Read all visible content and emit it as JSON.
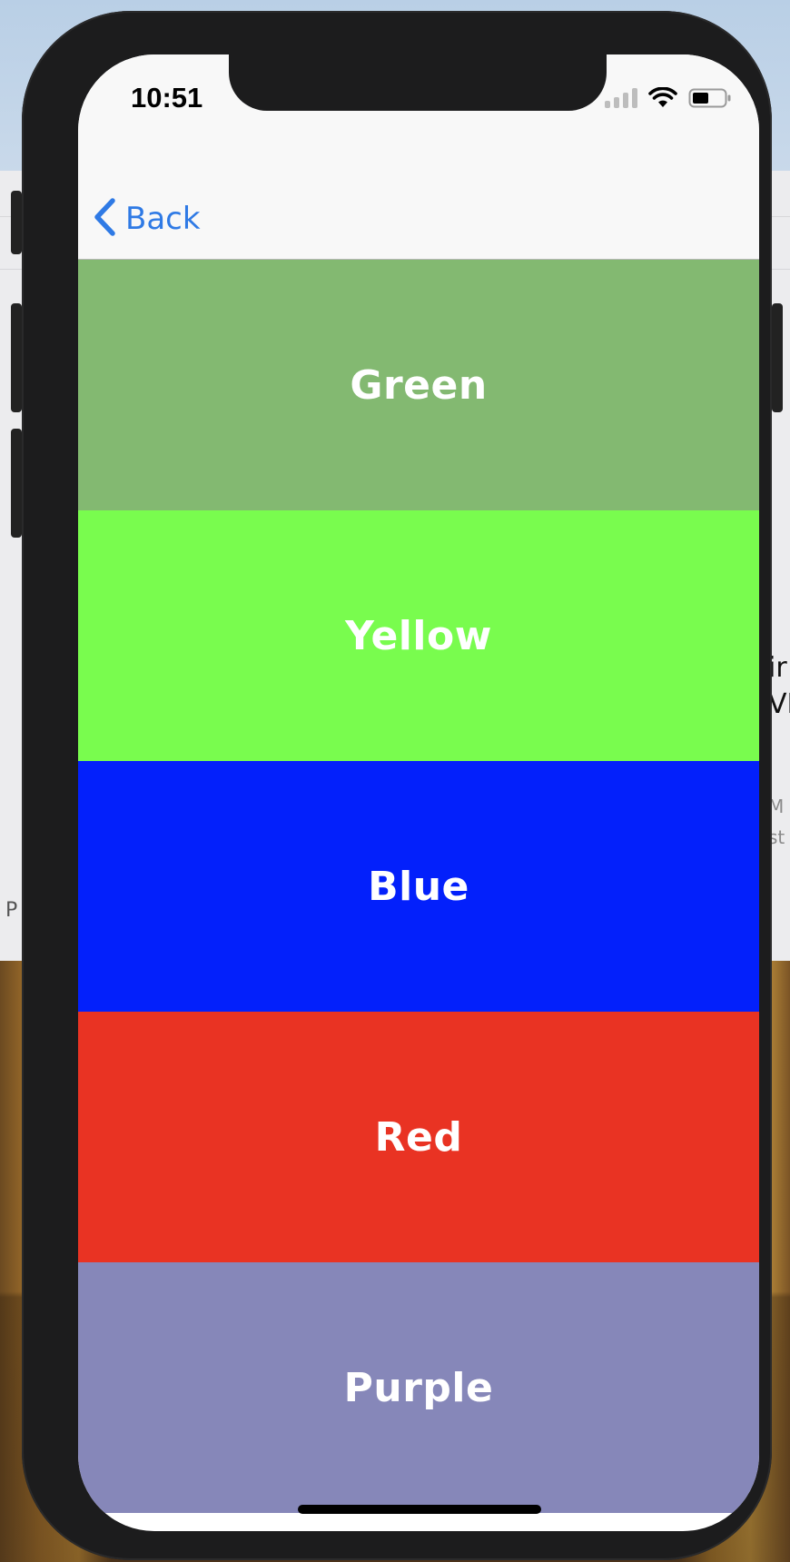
{
  "status_bar": {
    "time": "10:51",
    "icons": [
      "cellular-signal-icon",
      "wifi-icon",
      "battery-icon"
    ]
  },
  "nav": {
    "back_label": "Back",
    "back_icon": "chevron-left-icon",
    "accent": "#2f7ae5"
  },
  "color_rows": [
    {
      "label": "Green",
      "color": "#83b971"
    },
    {
      "label": "Yellow",
      "color": "#79fc4e"
    },
    {
      "label": "Blue",
      "color": "#0320fb"
    },
    {
      "label": "Red",
      "color": "#e93323"
    },
    {
      "label": "Purple",
      "color": "#8687b9"
    }
  ],
  "background_window": {
    "left_fragment": "P",
    "right_fragments": [
      "ir",
      "VI",
      "M",
      "st"
    ]
  }
}
